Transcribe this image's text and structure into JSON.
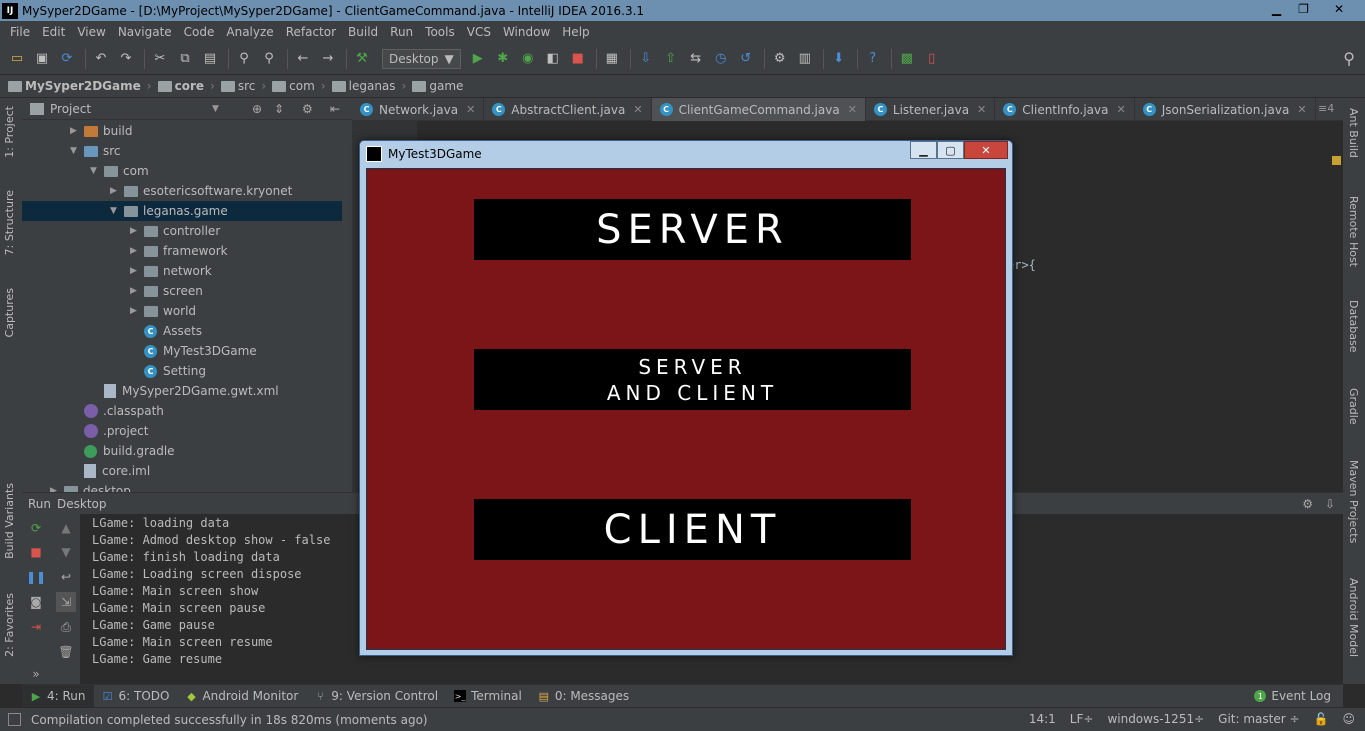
{
  "window": {
    "title": "MySyper2DGame - [D:\\MyProject\\MySyper2DGame] - ClientGameCommand.java - IntelliJ IDEA 2016.3.1",
    "logo": "IJ"
  },
  "menu": [
    "File",
    "Edit",
    "View",
    "Navigate",
    "Code",
    "Analyze",
    "Refactor",
    "Build",
    "Run",
    "Tools",
    "VCS",
    "Window",
    "Help"
  ],
  "toolbar": {
    "run_config": "Desktop"
  },
  "breadcrumb": [
    "MySyper2DGame",
    "core",
    "src",
    "com",
    "leganas",
    "game"
  ],
  "project_panel": {
    "title": "Project",
    "tree": [
      {
        "label": "build",
        "depth": 2,
        "arrow": "▶",
        "icon": "folder-orange"
      },
      {
        "label": "src",
        "depth": 2,
        "arrow": "▼",
        "icon": "folder-blue"
      },
      {
        "label": "com",
        "depth": 3,
        "arrow": "▼",
        "icon": "folder"
      },
      {
        "label": "esotericsoftware.kryonet",
        "depth": 4,
        "arrow": "▶",
        "icon": "folder"
      },
      {
        "label": "leganas.game",
        "depth": 4,
        "arrow": "▼",
        "icon": "folder",
        "selected": true
      },
      {
        "label": "controller",
        "depth": 5,
        "arrow": "▶",
        "icon": "folder"
      },
      {
        "label": "framework",
        "depth": 5,
        "arrow": "▶",
        "icon": "folder"
      },
      {
        "label": "network",
        "depth": 5,
        "arrow": "▶",
        "icon": "folder"
      },
      {
        "label": "screen",
        "depth": 5,
        "arrow": "▶",
        "icon": "folder"
      },
      {
        "label": "world",
        "depth": 5,
        "arrow": "▶",
        "icon": "folder"
      },
      {
        "label": "Assets",
        "depth": 5,
        "arrow": "",
        "icon": "class"
      },
      {
        "label": "MyTest3DGame",
        "depth": 5,
        "arrow": "",
        "icon": "class"
      },
      {
        "label": "Setting",
        "depth": 5,
        "arrow": "",
        "icon": "class"
      },
      {
        "label": "MySyper2DGame.gwt.xml",
        "depth": 3,
        "arrow": "",
        "icon": "file"
      },
      {
        "label": ".classpath",
        "depth": 2,
        "arrow": "",
        "icon": "eclipse"
      },
      {
        "label": ".project",
        "depth": 2,
        "arrow": "",
        "icon": "eclipse"
      },
      {
        "label": "build.gradle",
        "depth": 2,
        "arrow": "",
        "icon": "gradle"
      },
      {
        "label": "core.iml",
        "depth": 2,
        "arrow": "",
        "icon": "file"
      },
      {
        "label": "desktop",
        "depth": 1,
        "arrow": "▶",
        "icon": "folder"
      }
    ]
  },
  "editor_tabs": [
    {
      "label": "Network.java",
      "active": false
    },
    {
      "label": "AbstractClient.java",
      "active": false
    },
    {
      "label": "ClientGameCommand.java",
      "active": true
    },
    {
      "label": "Listener.java",
      "active": false
    },
    {
      "label": "ClientInfo.java",
      "active": false
    },
    {
      "label": "JsonSerialization.java",
      "active": false
    }
  ],
  "editor": {
    "visible_code": "er>{",
    "tab_count": "≡4"
  },
  "left_tool_tabs": [
    "1: Project",
    "7: Structure",
    "Captures",
    "Build Variants",
    "2: Favorites"
  ],
  "right_tool_tabs": [
    "Ant Build",
    "Remote Host",
    "Database",
    "Gradle",
    "Maven Projects",
    "Android Model"
  ],
  "run_panel": {
    "label": "Run",
    "config": "Desktop",
    "lines": [
      "LGame: loading data",
      "LGame: Admod desktop show - false",
      "LGame: finish loading data",
      "LGame: Loading screen dispose",
      "LGame: Main screen show",
      "LGame: Main screen pause",
      "LGame: Game pause",
      "LGame: Main screen resume",
      "LGame: Game resume"
    ]
  },
  "bottom_tabs": [
    {
      "label": "4: Run",
      "active": true
    },
    {
      "label": "6: TODO",
      "active": false
    },
    {
      "label": "Android Monitor",
      "active": false
    },
    {
      "label": "9: Version Control",
      "active": false
    },
    {
      "label": "Terminal",
      "active": false
    },
    {
      "label": "0: Messages",
      "active": false
    }
  ],
  "event_log": "Event Log",
  "status": {
    "message": "Compilation completed successfully in 18s 820ms (moments ago)",
    "position": "14:1",
    "line_sep": "LF÷",
    "encoding": "windows-1251÷",
    "git": "Git: master ÷"
  },
  "game_window": {
    "title": "MyTest3DGame",
    "buttons": {
      "server": "SERVER",
      "server_and_client_1": "SERVER",
      "server_and_client_2": "AND CLIENT",
      "client": "CLIENT"
    },
    "colors": {
      "background": "#7b1518",
      "button": "#000000"
    }
  }
}
